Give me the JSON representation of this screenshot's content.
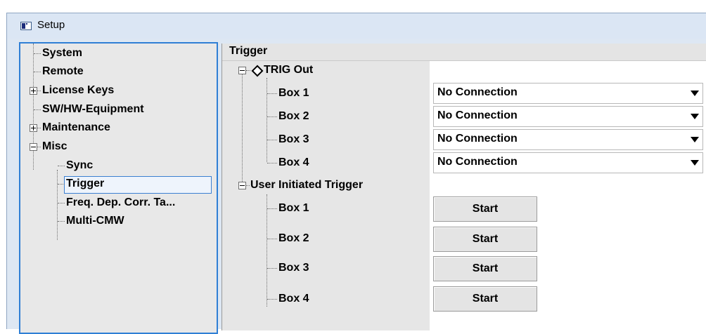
{
  "window": {
    "title": "Setup"
  },
  "nav_tree": {
    "items": [
      {
        "label": "System"
      },
      {
        "label": "Remote"
      },
      {
        "label": "License Keys"
      },
      {
        "label": "SW/HW-Equipment"
      },
      {
        "label": "Maintenance"
      },
      {
        "label": "Misc"
      },
      {
        "label": "Sync"
      },
      {
        "label": "Trigger",
        "selected": true
      },
      {
        "label": "Freq. Dep. Corr. Ta..."
      },
      {
        "label": "Multi-CMW"
      }
    ]
  },
  "panel": {
    "title": "Trigger",
    "trig_out": {
      "label": "TRIG Out",
      "boxes": [
        {
          "label": "Box 1",
          "value": "No Connection"
        },
        {
          "label": "Box 2",
          "value": "No Connection"
        },
        {
          "label": "Box 3",
          "value": "No Connection"
        },
        {
          "label": "Box 4",
          "value": "No Connection"
        }
      ]
    },
    "user_trigger": {
      "label": "User Initiated Trigger",
      "boxes": [
        {
          "label": "Box 1",
          "button": "Start"
        },
        {
          "label": "Box 2",
          "button": "Start"
        },
        {
          "label": "Box 3",
          "button": "Start"
        },
        {
          "label": "Box 4",
          "button": "Start"
        }
      ]
    }
  }
}
